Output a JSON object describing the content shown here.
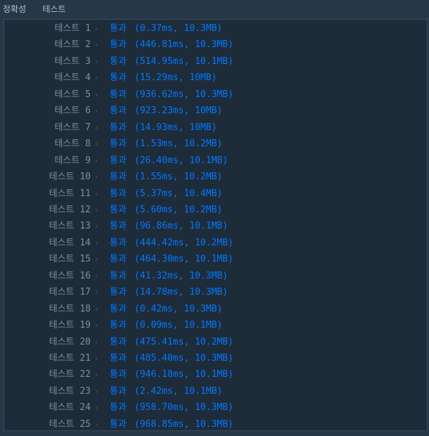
{
  "header": {
    "title": "정확성",
    "section": "테스트"
  },
  "icons": {
    "row_separator": "chevron-right-icon"
  },
  "colors": {
    "pass": "#0078ff",
    "label": "#78909c",
    "background": "#263747",
    "panel": "#1e2c3a"
  },
  "results": [
    {
      "label": "테스트 1",
      "status": "통과",
      "meta": "(0.37ms, 10.3MB)"
    },
    {
      "label": "테스트 2",
      "status": "통과",
      "meta": "(446.81ms, 10.3MB)"
    },
    {
      "label": "테스트 3",
      "status": "통과",
      "meta": "(514.95ms, 10.1MB)"
    },
    {
      "label": "테스트 4",
      "status": "통과",
      "meta": "(15.29ms, 10MB)"
    },
    {
      "label": "테스트 5",
      "status": "통과",
      "meta": "(936.62ms, 10.3MB)"
    },
    {
      "label": "테스트 6",
      "status": "통과",
      "meta": "(923.23ms, 10MB)"
    },
    {
      "label": "테스트 7",
      "status": "통과",
      "meta": "(14.93ms, 10MB)"
    },
    {
      "label": "테스트 8",
      "status": "통과",
      "meta": "(1.53ms, 10.2MB)"
    },
    {
      "label": "테스트 9",
      "status": "통과",
      "meta": "(26.40ms, 10.1MB)"
    },
    {
      "label": "테스트 10",
      "status": "통과",
      "meta": "(1.55ms, 10.2MB)"
    },
    {
      "label": "테스트 11",
      "status": "통과",
      "meta": "(5.37ms, 10.4MB)"
    },
    {
      "label": "테스트 12",
      "status": "통과",
      "meta": "(5.60ms, 10.2MB)"
    },
    {
      "label": "테스트 13",
      "status": "통과",
      "meta": "(96.86ms, 10.1MB)"
    },
    {
      "label": "테스트 14",
      "status": "통과",
      "meta": "(444.42ms, 10.2MB)"
    },
    {
      "label": "테스트 15",
      "status": "통과",
      "meta": "(464.30ms, 10.1MB)"
    },
    {
      "label": "테스트 16",
      "status": "통과",
      "meta": "(41.32ms, 10.3MB)"
    },
    {
      "label": "테스트 17",
      "status": "통과",
      "meta": "(14.78ms, 10.3MB)"
    },
    {
      "label": "테스트 18",
      "status": "통과",
      "meta": "(0.42ms, 10.3MB)"
    },
    {
      "label": "테스트 19",
      "status": "통과",
      "meta": "(0.09ms, 10.1MB)"
    },
    {
      "label": "테스트 20",
      "status": "통과",
      "meta": "(475.41ms, 10.2MB)"
    },
    {
      "label": "테스트 21",
      "status": "통과",
      "meta": "(485.40ms, 10.3MB)"
    },
    {
      "label": "테스트 22",
      "status": "통과",
      "meta": "(946.18ms, 10.1MB)"
    },
    {
      "label": "테스트 23",
      "status": "통과",
      "meta": "(2.42ms, 10.1MB)"
    },
    {
      "label": "테스트 24",
      "status": "통과",
      "meta": "(958.70ms, 10.3MB)"
    },
    {
      "label": "테스트 25",
      "status": "통과",
      "meta": "(968.85ms, 10.3MB)"
    }
  ]
}
